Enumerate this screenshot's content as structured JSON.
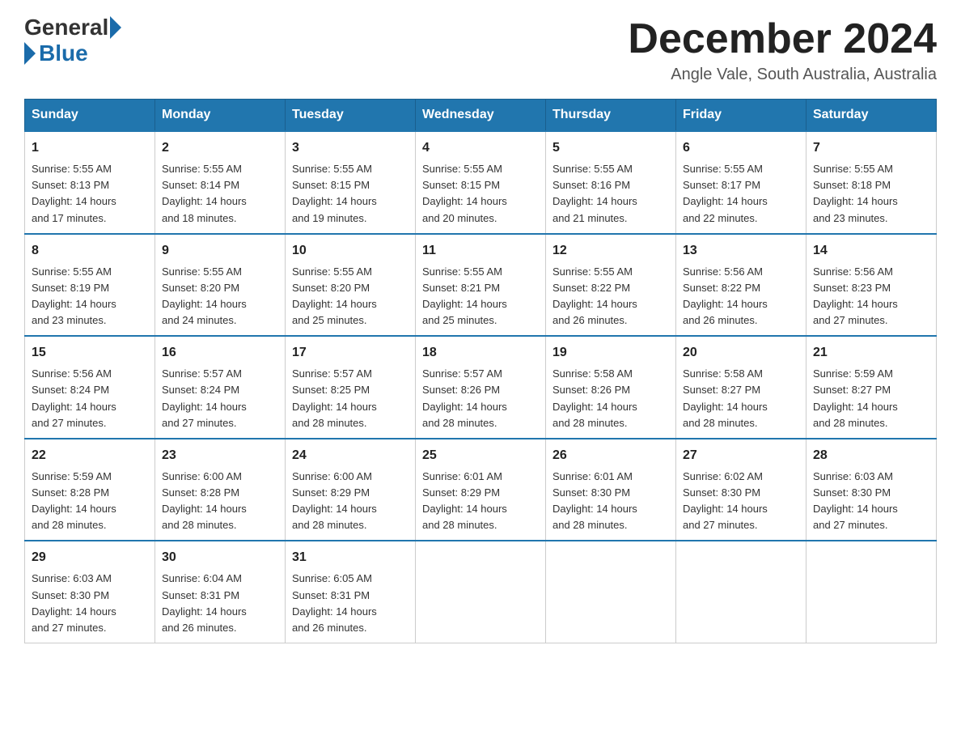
{
  "logo": {
    "general": "General",
    "blue": "Blue"
  },
  "title": "December 2024",
  "subtitle": "Angle Vale, South Australia, Australia",
  "days_of_week": [
    "Sunday",
    "Monday",
    "Tuesday",
    "Wednesday",
    "Thursday",
    "Friday",
    "Saturday"
  ],
  "weeks": [
    [
      {
        "day": "1",
        "info": "Sunrise: 5:55 AM\nSunset: 8:13 PM\nDaylight: 14 hours\nand 17 minutes."
      },
      {
        "day": "2",
        "info": "Sunrise: 5:55 AM\nSunset: 8:14 PM\nDaylight: 14 hours\nand 18 minutes."
      },
      {
        "day": "3",
        "info": "Sunrise: 5:55 AM\nSunset: 8:15 PM\nDaylight: 14 hours\nand 19 minutes."
      },
      {
        "day": "4",
        "info": "Sunrise: 5:55 AM\nSunset: 8:15 PM\nDaylight: 14 hours\nand 20 minutes."
      },
      {
        "day": "5",
        "info": "Sunrise: 5:55 AM\nSunset: 8:16 PM\nDaylight: 14 hours\nand 21 minutes."
      },
      {
        "day": "6",
        "info": "Sunrise: 5:55 AM\nSunset: 8:17 PM\nDaylight: 14 hours\nand 22 minutes."
      },
      {
        "day": "7",
        "info": "Sunrise: 5:55 AM\nSunset: 8:18 PM\nDaylight: 14 hours\nand 23 minutes."
      }
    ],
    [
      {
        "day": "8",
        "info": "Sunrise: 5:55 AM\nSunset: 8:19 PM\nDaylight: 14 hours\nand 23 minutes."
      },
      {
        "day": "9",
        "info": "Sunrise: 5:55 AM\nSunset: 8:20 PM\nDaylight: 14 hours\nand 24 minutes."
      },
      {
        "day": "10",
        "info": "Sunrise: 5:55 AM\nSunset: 8:20 PM\nDaylight: 14 hours\nand 25 minutes."
      },
      {
        "day": "11",
        "info": "Sunrise: 5:55 AM\nSunset: 8:21 PM\nDaylight: 14 hours\nand 25 minutes."
      },
      {
        "day": "12",
        "info": "Sunrise: 5:55 AM\nSunset: 8:22 PM\nDaylight: 14 hours\nand 26 minutes."
      },
      {
        "day": "13",
        "info": "Sunrise: 5:56 AM\nSunset: 8:22 PM\nDaylight: 14 hours\nand 26 minutes."
      },
      {
        "day": "14",
        "info": "Sunrise: 5:56 AM\nSunset: 8:23 PM\nDaylight: 14 hours\nand 27 minutes."
      }
    ],
    [
      {
        "day": "15",
        "info": "Sunrise: 5:56 AM\nSunset: 8:24 PM\nDaylight: 14 hours\nand 27 minutes."
      },
      {
        "day": "16",
        "info": "Sunrise: 5:57 AM\nSunset: 8:24 PM\nDaylight: 14 hours\nand 27 minutes."
      },
      {
        "day": "17",
        "info": "Sunrise: 5:57 AM\nSunset: 8:25 PM\nDaylight: 14 hours\nand 28 minutes."
      },
      {
        "day": "18",
        "info": "Sunrise: 5:57 AM\nSunset: 8:26 PM\nDaylight: 14 hours\nand 28 minutes."
      },
      {
        "day": "19",
        "info": "Sunrise: 5:58 AM\nSunset: 8:26 PM\nDaylight: 14 hours\nand 28 minutes."
      },
      {
        "day": "20",
        "info": "Sunrise: 5:58 AM\nSunset: 8:27 PM\nDaylight: 14 hours\nand 28 minutes."
      },
      {
        "day": "21",
        "info": "Sunrise: 5:59 AM\nSunset: 8:27 PM\nDaylight: 14 hours\nand 28 minutes."
      }
    ],
    [
      {
        "day": "22",
        "info": "Sunrise: 5:59 AM\nSunset: 8:28 PM\nDaylight: 14 hours\nand 28 minutes."
      },
      {
        "day": "23",
        "info": "Sunrise: 6:00 AM\nSunset: 8:28 PM\nDaylight: 14 hours\nand 28 minutes."
      },
      {
        "day": "24",
        "info": "Sunrise: 6:00 AM\nSunset: 8:29 PM\nDaylight: 14 hours\nand 28 minutes."
      },
      {
        "day": "25",
        "info": "Sunrise: 6:01 AM\nSunset: 8:29 PM\nDaylight: 14 hours\nand 28 minutes."
      },
      {
        "day": "26",
        "info": "Sunrise: 6:01 AM\nSunset: 8:30 PM\nDaylight: 14 hours\nand 28 minutes."
      },
      {
        "day": "27",
        "info": "Sunrise: 6:02 AM\nSunset: 8:30 PM\nDaylight: 14 hours\nand 27 minutes."
      },
      {
        "day": "28",
        "info": "Sunrise: 6:03 AM\nSunset: 8:30 PM\nDaylight: 14 hours\nand 27 minutes."
      }
    ],
    [
      {
        "day": "29",
        "info": "Sunrise: 6:03 AM\nSunset: 8:30 PM\nDaylight: 14 hours\nand 27 minutes."
      },
      {
        "day": "30",
        "info": "Sunrise: 6:04 AM\nSunset: 8:31 PM\nDaylight: 14 hours\nand 26 minutes."
      },
      {
        "day": "31",
        "info": "Sunrise: 6:05 AM\nSunset: 8:31 PM\nDaylight: 14 hours\nand 26 minutes."
      },
      {
        "day": "",
        "info": ""
      },
      {
        "day": "",
        "info": ""
      },
      {
        "day": "",
        "info": ""
      },
      {
        "day": "",
        "info": ""
      }
    ]
  ]
}
